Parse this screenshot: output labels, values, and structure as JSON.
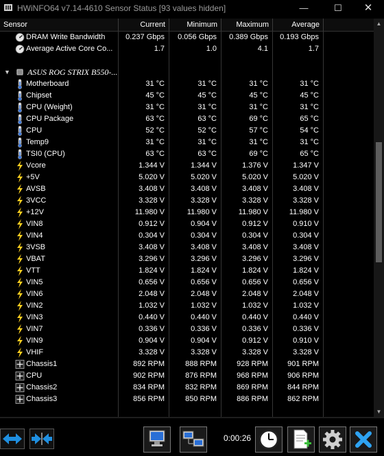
{
  "window": {
    "title": "HWiNFO64 v7.14-4610 Sensor Status [93 values hidden]",
    "minimize": "—",
    "maximize": "☐",
    "close": "✕"
  },
  "columns": {
    "sensor": "Sensor",
    "current": "Current",
    "minimum": "Minimum",
    "maximum": "Maximum",
    "average": "Average"
  },
  "rows": [
    {
      "type": "sensor",
      "icon": "gauge-icon",
      "label": "DRAM Write Bandwidth",
      "current": "0.237 Gbps",
      "minimum": "0.056 Gbps",
      "maximum": "0.389 Gbps",
      "average": "0.193 Gbps"
    },
    {
      "type": "sensor",
      "icon": "gauge-icon",
      "label": "Average Active Core Co...",
      "current": "1.7",
      "minimum": "1.0",
      "maximum": "4.1",
      "average": "1.7"
    },
    {
      "type": "blank"
    },
    {
      "type": "group",
      "icon": "chip-icon",
      "label": "ASUS ROG STRIX B550-..."
    },
    {
      "type": "sensor",
      "icon": "thermometer-icon",
      "label": "Motherboard",
      "current": "31 °C",
      "minimum": "31 °C",
      "maximum": "31 °C",
      "average": "31 °C"
    },
    {
      "type": "sensor",
      "icon": "thermometer-icon",
      "label": "Chipset",
      "current": "45 °C",
      "minimum": "45 °C",
      "maximum": "45 °C",
      "average": "45 °C"
    },
    {
      "type": "sensor",
      "icon": "thermometer-icon",
      "label": "CPU (Weight)",
      "current": "31 °C",
      "minimum": "31 °C",
      "maximum": "31 °C",
      "average": "31 °C"
    },
    {
      "type": "sensor",
      "icon": "thermometer-icon",
      "label": "CPU Package",
      "current": "63 °C",
      "minimum": "63 °C",
      "maximum": "69 °C",
      "average": "65 °C"
    },
    {
      "type": "sensor",
      "icon": "thermometer-icon",
      "label": "CPU",
      "current": "52 °C",
      "minimum": "52 °C",
      "maximum": "57 °C",
      "average": "54 °C"
    },
    {
      "type": "sensor",
      "icon": "thermometer-icon",
      "label": "Temp9",
      "current": "31 °C",
      "minimum": "31 °C",
      "maximum": "31 °C",
      "average": "31 °C"
    },
    {
      "type": "sensor",
      "icon": "thermometer-icon",
      "label": "TSI0 (CPU)",
      "current": "63 °C",
      "minimum": "63 °C",
      "maximum": "69 °C",
      "average": "65 °C"
    },
    {
      "type": "sensor",
      "icon": "lightning-icon",
      "label": "Vcore",
      "current": "1.344 V",
      "minimum": "1.344 V",
      "maximum": "1.376 V",
      "average": "1.347 V"
    },
    {
      "type": "sensor",
      "icon": "lightning-icon",
      "label": "+5V",
      "current": "5.020 V",
      "minimum": "5.020 V",
      "maximum": "5.020 V",
      "average": "5.020 V"
    },
    {
      "type": "sensor",
      "icon": "lightning-icon",
      "label": "AVSB",
      "current": "3.408 V",
      "minimum": "3.408 V",
      "maximum": "3.408 V",
      "average": "3.408 V"
    },
    {
      "type": "sensor",
      "icon": "lightning-icon",
      "label": "3VCC",
      "current": "3.328 V",
      "minimum": "3.328 V",
      "maximum": "3.328 V",
      "average": "3.328 V"
    },
    {
      "type": "sensor",
      "icon": "lightning-icon",
      "label": "+12V",
      "current": "11.980 V",
      "minimum": "11.980 V",
      "maximum": "11.980 V",
      "average": "11.980 V"
    },
    {
      "type": "sensor",
      "icon": "lightning-icon",
      "label": "VIN8",
      "current": "0.912 V",
      "minimum": "0.904 V",
      "maximum": "0.912 V",
      "average": "0.910 V"
    },
    {
      "type": "sensor",
      "icon": "lightning-icon",
      "label": "VIN4",
      "current": "0.304 V",
      "minimum": "0.304 V",
      "maximum": "0.304 V",
      "average": "0.304 V"
    },
    {
      "type": "sensor",
      "icon": "lightning-icon",
      "label": "3VSB",
      "current": "3.408 V",
      "minimum": "3.408 V",
      "maximum": "3.408 V",
      "average": "3.408 V"
    },
    {
      "type": "sensor",
      "icon": "lightning-icon",
      "label": "VBAT",
      "current": "3.296 V",
      "minimum": "3.296 V",
      "maximum": "3.296 V",
      "average": "3.296 V"
    },
    {
      "type": "sensor",
      "icon": "lightning-icon",
      "label": "VTT",
      "current": "1.824 V",
      "minimum": "1.824 V",
      "maximum": "1.824 V",
      "average": "1.824 V"
    },
    {
      "type": "sensor",
      "icon": "lightning-icon",
      "label": "VIN5",
      "current": "0.656 V",
      "minimum": "0.656 V",
      "maximum": "0.656 V",
      "average": "0.656 V"
    },
    {
      "type": "sensor",
      "icon": "lightning-icon",
      "label": "VIN6",
      "current": "2.048 V",
      "minimum": "2.048 V",
      "maximum": "2.048 V",
      "average": "2.048 V"
    },
    {
      "type": "sensor",
      "icon": "lightning-icon",
      "label": "VIN2",
      "current": "1.032 V",
      "minimum": "1.032 V",
      "maximum": "1.032 V",
      "average": "1.032 V"
    },
    {
      "type": "sensor",
      "icon": "lightning-icon",
      "label": "VIN3",
      "current": "0.440 V",
      "minimum": "0.440 V",
      "maximum": "0.440 V",
      "average": "0.440 V"
    },
    {
      "type": "sensor",
      "icon": "lightning-icon",
      "label": "VIN7",
      "current": "0.336 V",
      "minimum": "0.336 V",
      "maximum": "0.336 V",
      "average": "0.336 V"
    },
    {
      "type": "sensor",
      "icon": "lightning-icon",
      "label": "VIN9",
      "current": "0.904 V",
      "minimum": "0.904 V",
      "maximum": "0.912 V",
      "average": "0.910 V"
    },
    {
      "type": "sensor",
      "icon": "lightning-icon",
      "label": "VHIF",
      "current": "3.328 V",
      "minimum": "3.328 V",
      "maximum": "3.328 V",
      "average": "3.328 V"
    },
    {
      "type": "sensor",
      "icon": "fan-icon",
      "label": "Chassis1",
      "current": "892 RPM",
      "minimum": "888 RPM",
      "maximum": "928 RPM",
      "average": "901 RPM"
    },
    {
      "type": "sensor",
      "icon": "fan-icon",
      "label": "CPU",
      "current": "902 RPM",
      "minimum": "876 RPM",
      "maximum": "968 RPM",
      "average": "906 RPM"
    },
    {
      "type": "sensor",
      "icon": "fan-icon",
      "label": "Chassis2",
      "current": "834 RPM",
      "minimum": "832 RPM",
      "maximum": "869 RPM",
      "average": "844 RPM"
    },
    {
      "type": "sensor",
      "icon": "fan-icon",
      "label": "Chassis3",
      "current": "856 RPM",
      "minimum": "850 RPM",
      "maximum": "886 RPM",
      "average": "862 RPM"
    },
    {
      "type": "blank"
    }
  ],
  "toolbar": {
    "elapsed_time": "0:00:26",
    "buttons": [
      "nav-arrows-icon",
      "collapse-arrows-icon",
      "network-monitor-icon",
      "network-computers-icon",
      "clock-icon",
      "add-report-icon",
      "gear-icon",
      "close-x-icon"
    ]
  },
  "colors": {
    "background": "#000000",
    "grid": "#363636",
    "text": "#ffffff",
    "accent_blue": "#1f8fe0",
    "bolt_yellow": "#ffd21f"
  }
}
